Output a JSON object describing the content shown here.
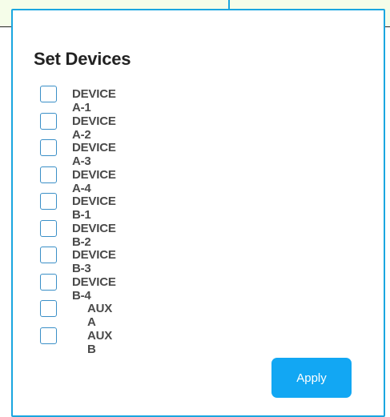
{
  "dialog": {
    "title": "Set Devices",
    "devices": [
      {
        "label": "DEVICE A-1",
        "checked": false
      },
      {
        "label": "DEVICE A-2",
        "checked": false
      },
      {
        "label": "DEVICE A-3",
        "checked": false
      },
      {
        "label": "DEVICE A-4",
        "checked": false
      },
      {
        "label": "DEVICE B-1",
        "checked": false
      },
      {
        "label": "DEVICE B-2",
        "checked": false
      },
      {
        "label": "DEVICE B-3",
        "checked": false
      },
      {
        "label": "DEVICE B-4",
        "checked": false
      },
      {
        "label": "AUX A",
        "checked": false
      },
      {
        "label": "AUX B",
        "checked": false
      }
    ],
    "apply_label": "Apply"
  },
  "colors": {
    "accent": "#1aa6e0",
    "button": "#12a7f3",
    "checkbox_border": "#3a8fc7",
    "background_strip": "#f5fde9"
  }
}
